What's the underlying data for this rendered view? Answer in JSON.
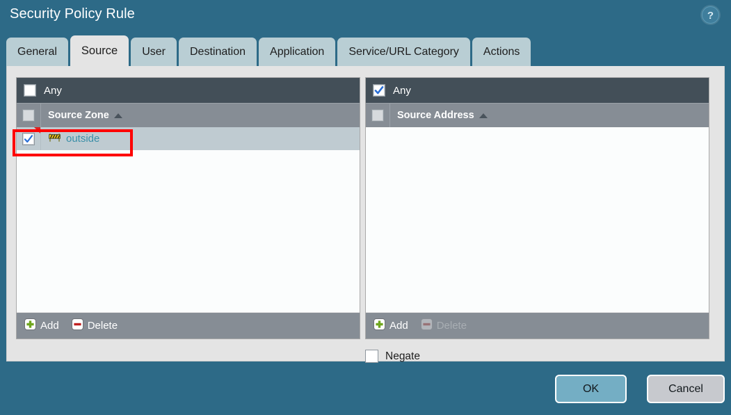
{
  "window": {
    "title": "Security Policy Rule",
    "help_icon": "help-circle-icon"
  },
  "tabs": [
    {
      "label": "General",
      "active": false
    },
    {
      "label": "Source",
      "active": true
    },
    {
      "label": "User",
      "active": false
    },
    {
      "label": "Destination",
      "active": false
    },
    {
      "label": "Application",
      "active": false
    },
    {
      "label": "Service/URL Category",
      "active": false
    },
    {
      "label": "Actions",
      "active": false
    }
  ],
  "panels": {
    "source_zone": {
      "any_label": "Any",
      "any_checked": false,
      "column_header": "Source Zone",
      "sort_direction": "ascending",
      "header_checkbox_checked": false,
      "rows": [
        {
          "label": "outside",
          "checked": true,
          "icon": "zone-barrier-icon",
          "modified": true,
          "selected": true
        }
      ],
      "toolbar": {
        "add_label": "Add",
        "add_icon": "plus-icon",
        "delete_label": "Delete",
        "delete_icon": "minus-icon",
        "delete_disabled": false
      }
    },
    "source_address": {
      "any_label": "Any",
      "any_checked": true,
      "column_header": "Source Address",
      "sort_direction": "ascending",
      "header_checkbox_checked": false,
      "rows": [],
      "toolbar": {
        "add_label": "Add",
        "add_icon": "plus-icon",
        "delete_label": "Delete",
        "delete_icon": "minus-icon",
        "delete_disabled": true
      }
    }
  },
  "negate": {
    "label": "Negate",
    "checked": false
  },
  "footer": {
    "ok_label": "OK",
    "cancel_label": "Cancel"
  },
  "annotation": {
    "type": "highlight-rectangle",
    "color": "#fe0000",
    "target": "outside"
  },
  "colors": {
    "dialog_background": "#2d6a87",
    "content_background": "#e4e4e4",
    "tab_inactive": "#b9ced4",
    "tab_active": "#e4e4e4",
    "any_bar": "#434f58",
    "column_header": "#868d95",
    "row_selected": "#bfcbd1",
    "link_text": "#3b8fa8",
    "ok_button": "#74aec4",
    "cancel_button": "#c7c9ce",
    "annotation": "#fe0000"
  }
}
